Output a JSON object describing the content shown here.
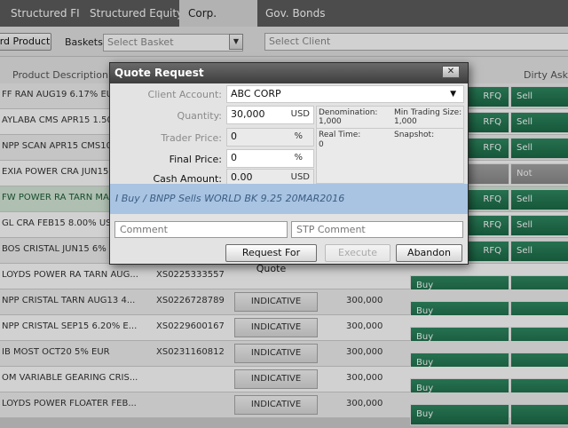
{
  "tabs": [
    {
      "label": "Structured FI"
    },
    {
      "label": "Structured Equity"
    },
    {
      "label": "Corp. Bonds"
    },
    {
      "label": "Gov. Bonds"
    }
  ],
  "toolbar": {
    "add_product_label": "rd Product",
    "baskets_label": "Baskets:",
    "basket_placeholder": "Select Basket",
    "client_placeholder": "Select Client"
  },
  "grid": {
    "columns": {
      "description": "Product Description",
      "dirty_ask": "Dirty Ask"
    },
    "rows": [
      {
        "desc": "FF RAN AUG19 6.17% EU",
        "isin": "",
        "indicative": "",
        "qty": "",
        "rfq": "RFQ",
        "action": "Sell"
      },
      {
        "desc": "AYLABA CMS APR15 1.50",
        "isin": "",
        "indicative": "",
        "qty": "",
        "rfq": "RFQ",
        "action": "Sell"
      },
      {
        "desc": "NPP SCAN APR15 CMS10",
        "isin": "",
        "indicative": "",
        "qty": "",
        "rfq": "RFQ",
        "action": "Sell"
      },
      {
        "desc": "EXIA POWER CRA JUN15",
        "isin": "",
        "indicative": "",
        "qty": "",
        "rfq": "",
        "action": "Not Tradable"
      },
      {
        "desc": "FW POWER RA TARN MA",
        "isin": "",
        "indicative": "",
        "qty": "",
        "rfq": "RFQ",
        "action": "Sell"
      },
      {
        "desc": "GL CRA FEB15 8.00% US",
        "isin": "",
        "indicative": "",
        "qty": "",
        "rfq": "RFQ",
        "action": "Sell"
      },
      {
        "desc": "BOS CRISTAL JUN15 6%",
        "isin": "",
        "indicative": "",
        "qty": "",
        "rfq": "RFQ",
        "action": "Sell"
      },
      {
        "desc": "LOYDS POWER RA TARN AUG...",
        "isin": "XS0225333557",
        "indicative": "",
        "qty": "",
        "rfq": "",
        "action": "Buy"
      },
      {
        "desc": "NPP CRISTAL TARN AUG13 4...",
        "isin": "XS0226728789",
        "indicative": "INDICATIVE",
        "qty": "300,000",
        "rfq": "",
        "action": "Buy"
      },
      {
        "desc": "NPP CRISTAL SEP15 6.20% E...",
        "isin": "XS0229600167",
        "indicative": "INDICATIVE",
        "qty": "300,000",
        "rfq": "",
        "action": "Buy"
      },
      {
        "desc": "IB MOST OCT20 5% EUR",
        "isin": "XS0231160812",
        "indicative": "INDICATIVE",
        "qty": "300,000",
        "rfq": "",
        "action": "Buy"
      },
      {
        "desc": "OM VARIABLE GEARING CRIS...",
        "isin": "",
        "indicative": "INDICATIVE",
        "qty": "300,000",
        "rfq": "",
        "action": "Buy"
      },
      {
        "desc": "LOYDS POWER FLOATER FEB...",
        "isin": "",
        "indicative": "INDICATIVE",
        "qty": "300,000",
        "rfq": "",
        "action": "Buy"
      }
    ]
  },
  "modal": {
    "title": "Quote Request",
    "close_label": "✕",
    "client_account_label": "Client Account:",
    "client_account_value": "ABC CORP",
    "quantity_label": "Quantity:",
    "quantity_value": "30,000",
    "quantity_unit": "USD",
    "trader_price_label": "Trader Price:",
    "trader_price_value": "0",
    "trader_price_unit": "%",
    "final_price_label": "Final Price:",
    "final_price_value": "0",
    "final_price_unit": "%",
    "cash_amount_label": "Cash Amount:",
    "cash_amount_value": "0.00",
    "cash_amount_unit": "USD",
    "denomination_label": "Denomination:",
    "denomination_value": "1,000",
    "min_trading_label": "Min Trading Size:",
    "min_trading_value": "1,000",
    "real_time_label": "Real Time:",
    "real_time_value": "0",
    "snapshot_label": "Snapshot:",
    "banner_text": "I Buy / BNPP Sells  WORLD BK 9.25 20MAR2016",
    "comment_placeholder": "Comment",
    "stp_comment_placeholder": "STP Comment",
    "request_button": "Request For Quote",
    "execute_button": "Execute",
    "abandon_button": "Abandon"
  }
}
